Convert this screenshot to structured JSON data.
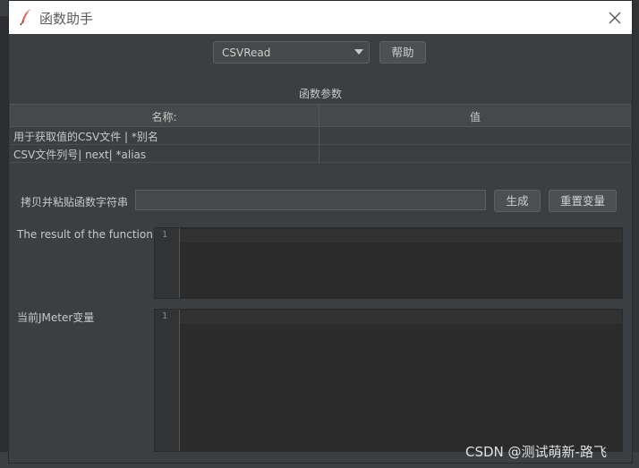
{
  "window": {
    "title": "函数助手"
  },
  "function_selector": {
    "selected": "CSVRead",
    "help_label": "帮助"
  },
  "parameters": {
    "section_title": "函数参数",
    "headers": [
      "名称:",
      "值"
    ],
    "rows": [
      {
        "name": "用于获取值的CSV文件 | *别名",
        "value": ""
      },
      {
        "name": "CSV文件列号| next| *alias",
        "value": ""
      }
    ]
  },
  "function_string": {
    "label": "拷贝并粘贴函数字符串",
    "value": "",
    "generate_label": "生成",
    "reset_label": "重置变量"
  },
  "result": {
    "label": "The result of the function is",
    "line_number": "1"
  },
  "variables": {
    "label": "当前JMeter变量",
    "line_number": "1"
  },
  "watermark": "CSDN @测试萌新-路飞",
  "colors": {
    "background": "#3c3f41",
    "titlebar": "#ffffff",
    "editor": "#2b2b2b",
    "icon_red": "#c0392b"
  }
}
